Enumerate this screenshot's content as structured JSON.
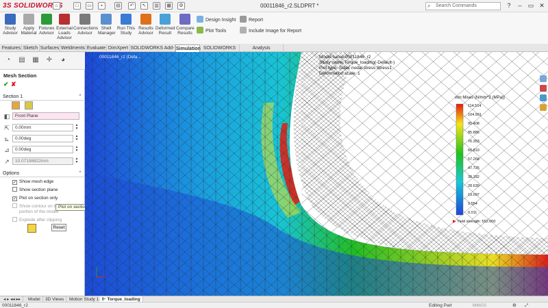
{
  "app": {
    "logo": "SOLIDWORKS",
    "logo_mark": "3S",
    "document_title": "00011846_r2.SLDPRT *"
  },
  "search": {
    "placeholder": "Search Commands"
  },
  "ribbon": {
    "buttons": [
      {
        "label": "Study Advisor",
        "icon": "study-advisor-icon"
      },
      {
        "label": "Apply Material",
        "icon": "apply-material-icon"
      },
      {
        "label": "Fixtures Advisor",
        "icon": "fixtures-icon"
      },
      {
        "label": "External Loads Advisor",
        "icon": "loads-icon"
      },
      {
        "label": "Connections Advisor",
        "icon": "connections-icon"
      },
      {
        "label": "Shell Manager",
        "icon": "shell-icon"
      },
      {
        "label": "Run This Study",
        "icon": "run-icon"
      },
      {
        "label": "Results Advisor",
        "icon": "results-icon"
      },
      {
        "label": "Deformed Result",
        "icon": "deformed-icon"
      },
      {
        "label": "Compare Results",
        "icon": "compare-icon"
      }
    ],
    "small": [
      "Design Insight",
      "Plot Tools",
      "Report",
      "Include Image for Report"
    ]
  },
  "command_tabs": [
    "Features",
    "Sketch",
    "Surfaces",
    "Weldments",
    "Evaluate",
    "DimXpert",
    "SOLIDWORKS Add-Ins",
    "Simulation",
    "SOLIDWORKS MBD",
    "Analysis Preparation"
  ],
  "active_tab": "Simulation",
  "panel": {
    "title": "Mesh Section",
    "section1": "Section 1",
    "plane": "Front Plane",
    "offset": "0.00mm",
    "angle1": "0.00deg",
    "angle2": "0.00deg",
    "distance": "10.07198822mm",
    "options": "Options",
    "checkboxes": [
      {
        "label": "Show mesh edge",
        "checked": true,
        "enabled": true
      },
      {
        "label": "Show section plane",
        "checked": false,
        "enabled": true
      },
      {
        "label": "Plot on section only",
        "checked": true,
        "enabled": true
      },
      {
        "label": "Show contour on the",
        "label2": "portion of the model",
        "checked": false,
        "enabled": false
      },
      {
        "label": "Explode after clipping",
        "checked": false,
        "enabled": false
      }
    ],
    "reset": "Reset",
    "tooltip": "Plot on section only"
  },
  "viewport": {
    "part_label": "00011846_r2 (Defa...",
    "info": [
      "Model name:00011846_r2",
      "Study name:Torque_loading(-Default-)",
      "Plot type: Static nodal stress Stress1",
      "Deformation scale: 1"
    ],
    "legend_title": "von Mises (N/mm^2 (MPa))",
    "legend_values": [
      "114.514",
      "104.931",
      "95.408",
      "85.886",
      "76.353",
      "66.810",
      "57.268",
      "47.725",
      "38.182",
      "28.639",
      "19.097",
      "9.554",
      "0.011"
    ],
    "yield": "Yield strength: 552.000",
    "colors": {
      "red": "#e61a0e",
      "yellow": "#f5e51a",
      "green": "#22c21c",
      "cyan": "#19c9d6",
      "blue": "#1c46d8"
    }
  },
  "bottom_tabs": [
    "Model",
    "3D Views",
    "Motion Study 1",
    "Torque_loading"
  ],
  "status": {
    "left": "00011846_r2",
    "mode": "Editing Part",
    "units": "MMGS"
  }
}
